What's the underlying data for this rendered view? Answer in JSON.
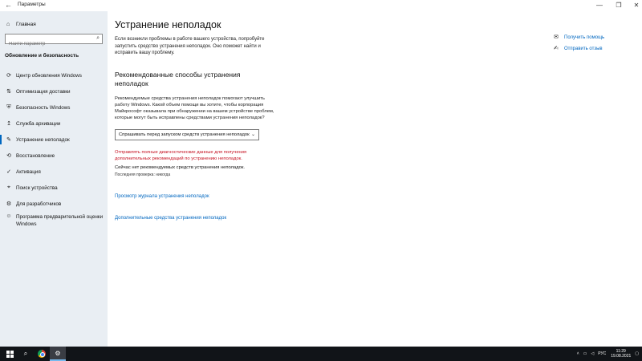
{
  "window": {
    "title": "Параметры",
    "back_icon": "back-arrow-icon",
    "controls": [
      "—",
      "❐",
      "✕"
    ]
  },
  "sidebar": {
    "home_label": "Главная",
    "search_placeholder": "Найти параметр",
    "section_title": "Обновление и безопасность",
    "items": [
      {
        "label": "Центр обновления Windows",
        "icon": "refresh-icon"
      },
      {
        "label": "Оптимизация доставки",
        "icon": "delivery-icon"
      },
      {
        "label": "Безопасность Windows",
        "icon": "shield-icon"
      },
      {
        "label": "Служба архивации",
        "icon": "backup-icon"
      },
      {
        "label": "Устранение неполадок",
        "icon": "wrench-icon",
        "active": true
      },
      {
        "label": "Восстановление",
        "icon": "recovery-icon"
      },
      {
        "label": "Активация",
        "icon": "activation-icon"
      },
      {
        "label": "Поиск устройства",
        "icon": "find-device-icon"
      },
      {
        "label": "Для разработчиков",
        "icon": "developer-icon"
      },
      {
        "label": "Программа предварительной оценки Windows",
        "icon": "insider-icon"
      }
    ]
  },
  "main": {
    "title": "Устранение неполадок",
    "intro": "Если возникли проблемы в работе вашего устройства, попробуйте запустить средство устранения неполадок. Оно поможет найти и исправить вашу проблему.",
    "recommended_title": "Рекомендованные способы устранения неполадок",
    "recommended_text": "Рекомендуемые средства устранения неполадок помогают улучшить работу Windows. Какой объем помощи вы хотите, чтобы корпорация Майкрософт оказывала при обнаружении на вашем устройстве проблем, которые могут быть исправлены средствами устранения неполадок?",
    "dropdown_value": "Спрашивать перед запуском средств устранения неполадок",
    "warning": "Отправлять полные диагностические данные для получения дополнительных рекомендаций по устранению неполадок.",
    "no_recommended": "Сейчас нет рекомендуемых средств устранения неполадок.",
    "last_check": "Последняя проверка: никогда",
    "link_history": "Просмотр журнала устранения неполадок",
    "link_additional": "Дополнительные средства устранения неполадок"
  },
  "help": {
    "get_help": "Получить помощь",
    "feedback": "Отправить отзыв"
  },
  "taskbar": {
    "tray_lang": "РУС",
    "time": "11:29",
    "date": "19.08.2021"
  }
}
